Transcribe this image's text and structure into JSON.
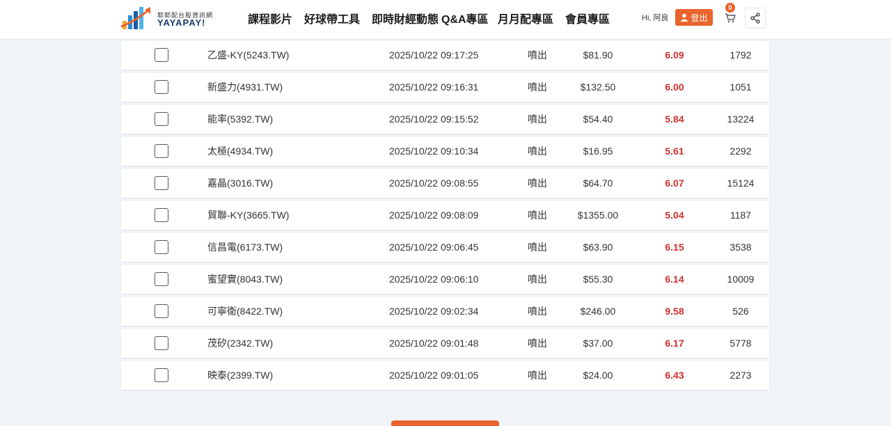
{
  "header": {
    "logo": {
      "sub": "耶耶配台股資訊網",
      "brand": "YAYAPAY!"
    },
    "nav": [
      {
        "label": "課程影片"
      },
      {
        "label": "好球帶工具"
      },
      {
        "label": "即時財經動態"
      },
      {
        "label": "Q&A專區"
      },
      {
        "label": "月月配專區"
      },
      {
        "label": "會員專區"
      }
    ],
    "greeting": "Hi,  阿良",
    "logout_label": "登出",
    "cart_count": "0",
    "colors": {
      "accent": "#e9642c",
      "positive": "#d32f2f"
    }
  },
  "rows": [
    {
      "name": "乙盛-KY(5243.TW)",
      "time": "2025/10/22 09:17:25",
      "type": "噴出",
      "price": "$81.90",
      "pct": "6.09",
      "volume": "1792"
    },
    {
      "name": "新盛力(4931.TW)",
      "time": "2025/10/22 09:16:31",
      "type": "噴出",
      "price": "$132.50",
      "pct": "6.00",
      "volume": "1051"
    },
    {
      "name": "能率(5392.TW)",
      "time": "2025/10/22 09:15:52",
      "type": "噴出",
      "price": "$54.40",
      "pct": "5.84",
      "volume": "13224"
    },
    {
      "name": "太極(4934.TW)",
      "time": "2025/10/22 09:10:34",
      "type": "噴出",
      "price": "$16.95",
      "pct": "5.61",
      "volume": "2292"
    },
    {
      "name": "嘉晶(3016.TW)",
      "time": "2025/10/22 09:08:55",
      "type": "噴出",
      "price": "$64.70",
      "pct": "6.07",
      "volume": "15124"
    },
    {
      "name": "貿聯-KY(3665.TW)",
      "time": "2025/10/22 09:08:09",
      "type": "噴出",
      "price": "$1355.00",
      "pct": "5.04",
      "volume": "1187"
    },
    {
      "name": "信昌電(6173.TW)",
      "time": "2025/10/22 09:06:45",
      "type": "噴出",
      "price": "$63.90",
      "pct": "6.15",
      "volume": "3538"
    },
    {
      "name": "蜜望實(8043.TW)",
      "time": "2025/10/22 09:06:10",
      "type": "噴出",
      "price": "$55.30",
      "pct": "6.14",
      "volume": "10009"
    },
    {
      "name": "可寧衛(8422.TW)",
      "time": "2025/10/22 09:02:34",
      "type": "噴出",
      "price": "$246.00",
      "pct": "9.58",
      "volume": "526"
    },
    {
      "name": "茂矽(2342.TW)",
      "time": "2025/10/22 09:01:48",
      "type": "噴出",
      "price": "$37.00",
      "pct": "6.17",
      "volume": "5778"
    },
    {
      "name": "映泰(2399.TW)",
      "time": "2025/10/22 09:01:05",
      "type": "噴出",
      "price": "$24.00",
      "pct": "6.43",
      "volume": "2273"
    }
  ]
}
